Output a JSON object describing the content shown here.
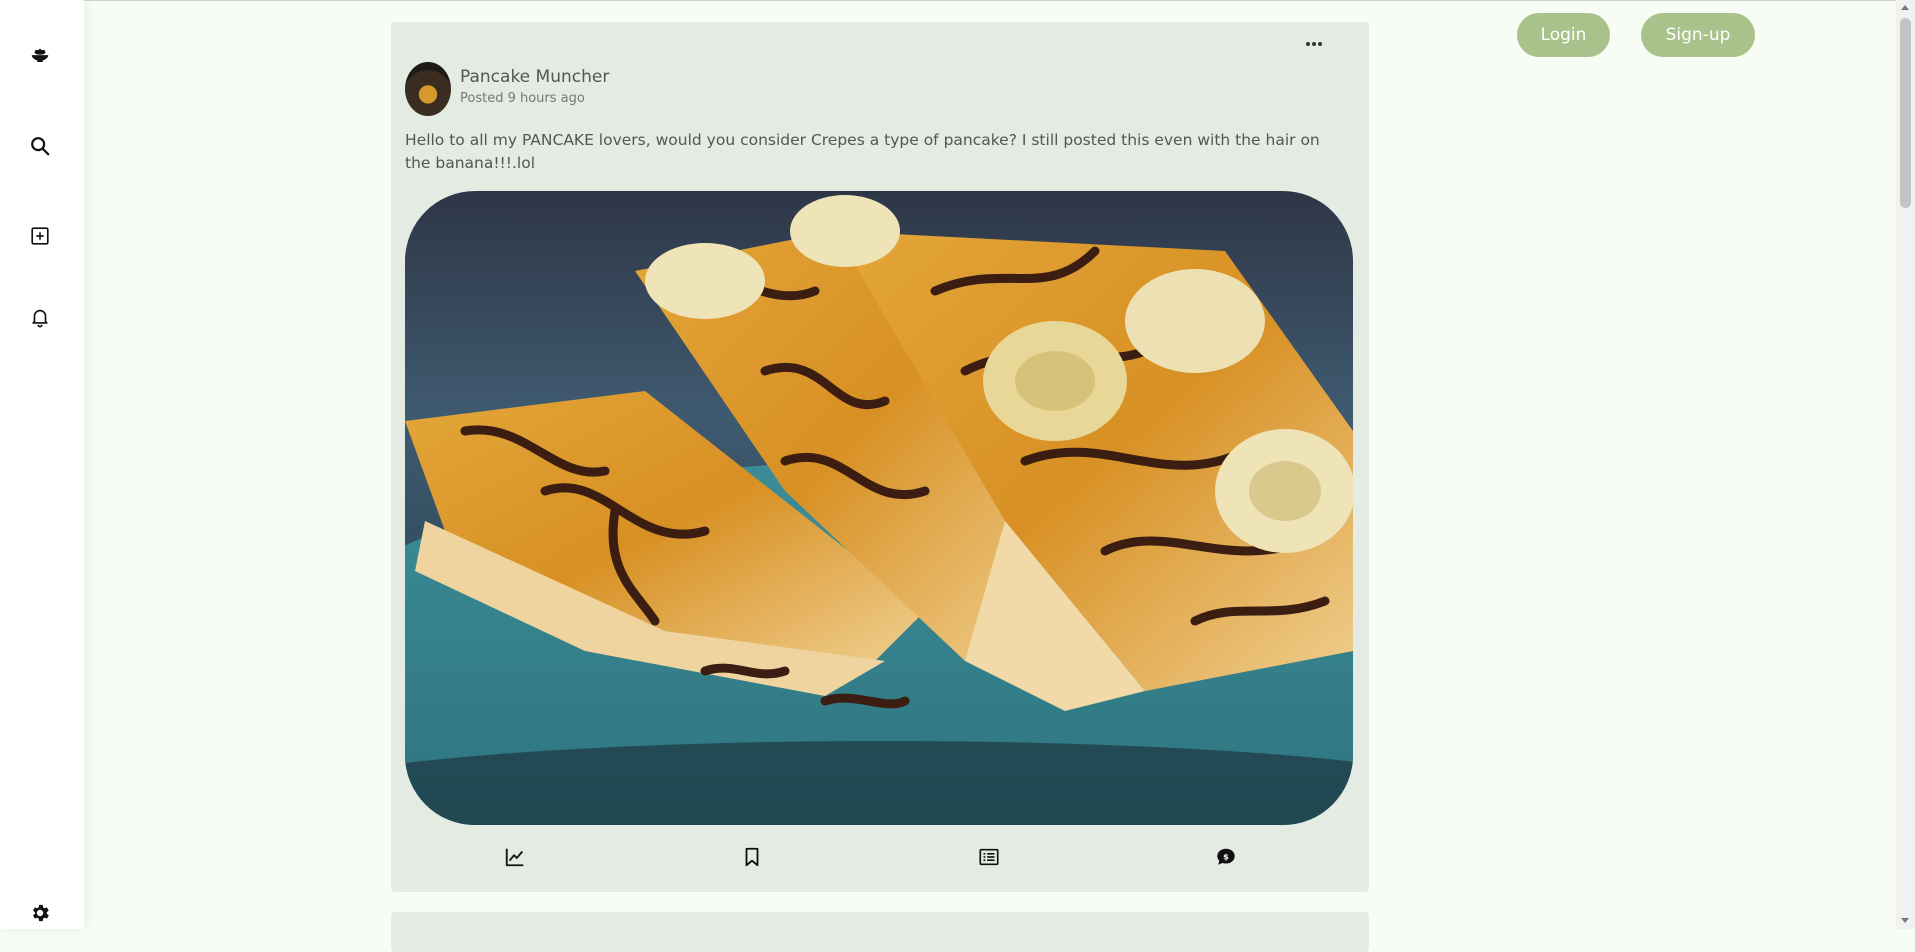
{
  "auth": {
    "login_label": "Login",
    "signup_label": "Sign-up"
  },
  "sidebar": {
    "icons": [
      "bowl-icon",
      "search-icon",
      "add-post-icon",
      "bell-icon",
      "gear-icon"
    ]
  },
  "post": {
    "author": "Pancake Muncher",
    "posted": "Posted 9 hours ago",
    "text": "Hello to all my PANCAKE lovers, would you consider Crepes a type of pancake? I still posted this even with the hair on the banana!!!.lol",
    "image": "crepes-with-banana-and-chocolate",
    "actions": [
      "stats-icon",
      "bookmark-icon",
      "list-icon",
      "comment-icon"
    ]
  },
  "colors": {
    "accent": "#a9c28b",
    "card": "#e4ebe2",
    "background": "#f7fdf4"
  }
}
